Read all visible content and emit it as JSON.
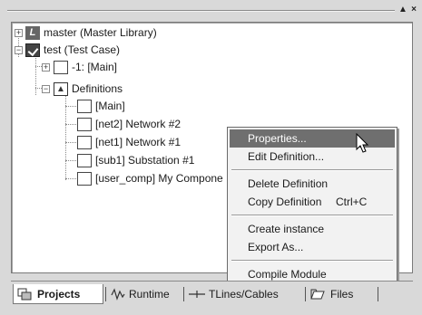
{
  "header": {
    "scroll_up_symbol": "▲",
    "close_symbol": "×"
  },
  "tree": {
    "master": "master (Master Library)",
    "test": "test (Test Case)",
    "main_instance": "-1: [Main]",
    "definitions": "Definitions",
    "def_main": "[Main]",
    "def_net2": "[net2] Network #2",
    "def_net1": "[net1] Network #1",
    "def_sub1": "[sub1] Substation #1",
    "def_user_comp": "[user_comp] My Compone",
    "expand_symbol": "+",
    "collapse_symbol": "−",
    "lib_icon_letter": "L"
  },
  "context_menu": {
    "properties": "Properties...",
    "edit_definition": "Edit Definition...",
    "delete_definition": "Delete Definition",
    "copy_definition": "Copy Definition",
    "copy_shortcut": "Ctrl+C",
    "create_instance": "Create instance",
    "export_as": "Export As...",
    "compile_module": "Compile Module",
    "highlighted_item": "Properties..."
  },
  "tabs": {
    "projects": "Projects",
    "runtime": "Runtime",
    "tlines": "TLines/Cables",
    "files": "Files",
    "active": "Projects"
  },
  "colors": {
    "panel_bg": "#ffffff",
    "chrome_bg": "#d9d9d9",
    "menu_bg": "#f2f2f2",
    "menu_highlight": "#6f6f6f"
  }
}
